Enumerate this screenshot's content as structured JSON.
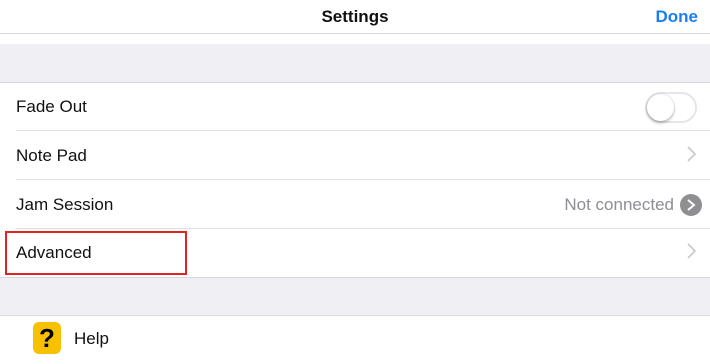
{
  "header": {
    "title": "Settings",
    "done_label": "Done"
  },
  "rows": {
    "fade_out": {
      "label": "Fade Out",
      "toggle_on": false
    },
    "note_pad": {
      "label": "Note Pad"
    },
    "jam_session": {
      "label": "Jam Session",
      "status": "Not connected"
    },
    "advanced": {
      "label": "Advanced"
    },
    "help": {
      "label": "Help",
      "icon_glyph": "?"
    }
  },
  "colors": {
    "accent": "#1a7ff2",
    "highlight": "#e02424",
    "help_icon": "#f7c100",
    "group_bg": "#efeff4"
  },
  "icons": {
    "chevron": "chevron-right-icon",
    "jam_arrow": "circle-arrow-right-icon",
    "help": "question-mark-icon"
  }
}
